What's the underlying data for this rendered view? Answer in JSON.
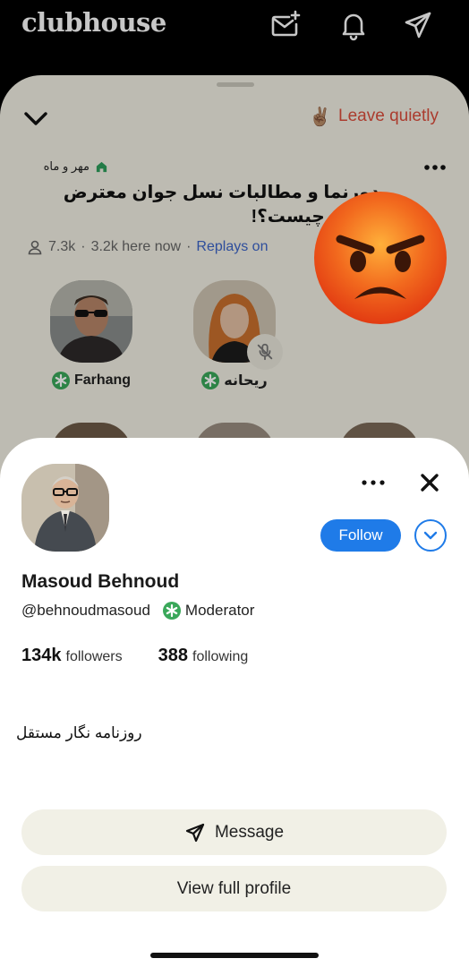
{
  "app": {
    "logo": "clubhouse"
  },
  "room": {
    "leave_label": "Leave quietly",
    "leave_emoji": "✌🏽",
    "club_name": "مهر و ماه",
    "title": "دورنما و مطالبات نسل جوان معترض امروز چیست؟!",
    "listeners": "7.3k",
    "here_now": "3.2k here now",
    "separator": "·",
    "replays": "Replays on",
    "speakers": [
      {
        "name": "Farhang",
        "moderator": true,
        "muted": false
      },
      {
        "name": "ریحانه",
        "moderator": true,
        "muted": true
      }
    ],
    "reaction_emoji": "angry-face"
  },
  "profile": {
    "name": "Masoud Behnoud",
    "handle": "@behnoudmasoud",
    "role": "Moderator",
    "followers_count": "134k",
    "followers_label": "followers",
    "following_count": "388",
    "following_label": "following",
    "bio": "روزنامه نگار مستقل",
    "follow_label": "Follow",
    "message_label": "Message",
    "view_profile_label": "View full profile"
  },
  "colors": {
    "accent": "#1f7be8",
    "leave": "#dc4d3c",
    "moderator_green": "#3aa85a",
    "room_bg": "#f2f0e4"
  }
}
